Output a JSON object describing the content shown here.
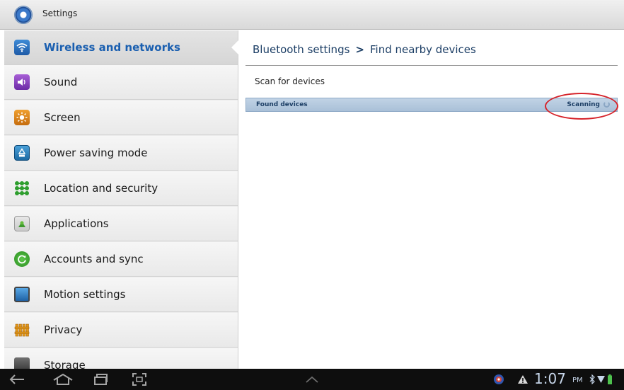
{
  "window": {
    "title": "Settings"
  },
  "sidebar": {
    "items": [
      {
        "label": "Wireless and networks",
        "icon": "wifi-icon",
        "active": true
      },
      {
        "label": "Sound",
        "icon": "speaker-icon",
        "active": false
      },
      {
        "label": "Screen",
        "icon": "brightness-icon",
        "active": false
      },
      {
        "label": "Power saving mode",
        "icon": "recycle-icon",
        "active": false
      },
      {
        "label": "Location and security",
        "icon": "grid-lock-icon",
        "active": false
      },
      {
        "label": "Applications",
        "icon": "android-icon",
        "active": false
      },
      {
        "label": "Accounts and sync",
        "icon": "sync-icon",
        "active": false
      },
      {
        "label": "Motion settings",
        "icon": "tablet-icon",
        "active": false
      },
      {
        "label": "Privacy",
        "icon": "fence-icon",
        "active": false
      },
      {
        "label": "Storage",
        "icon": "sd-card-icon",
        "active": false
      }
    ]
  },
  "main": {
    "breadcrumb": {
      "parent": "Bluetooth settings",
      "separator": ">",
      "current": "Find nearby devices"
    },
    "scan_label": "Scan for devices",
    "found_devices": {
      "label": "Found devices",
      "status": "Scanning"
    }
  },
  "statusbar": {
    "time": "1:07",
    "ampm": "PM",
    "icons": [
      "back-icon",
      "home-icon",
      "recent-apps-icon",
      "screenshot-icon",
      "up-arrow-icon",
      "app-notification-icon",
      "warning-icon",
      "bluetooth-icon",
      "wifi-status-icon",
      "battery-icon"
    ]
  },
  "colors": {
    "accent": "#1a5fb0",
    "found_bar": "#b5c9de",
    "highlight": "#d6232a"
  }
}
